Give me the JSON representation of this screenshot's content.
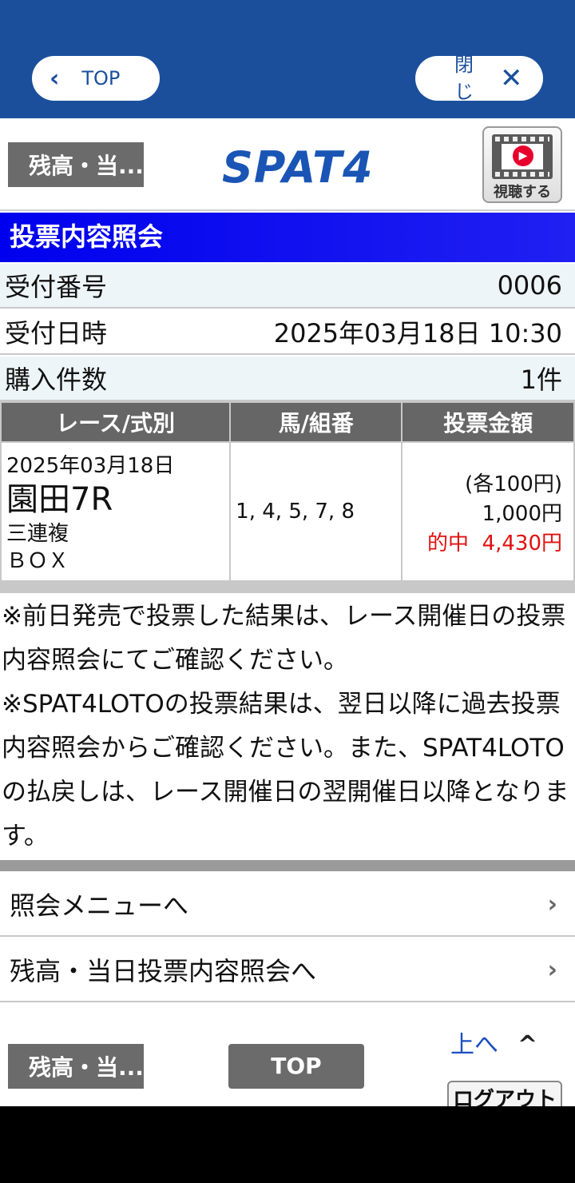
{
  "topbar": {
    "top_label": "TOP",
    "close_label": "閉じる"
  },
  "header": {
    "back_label": "残高・当...",
    "logo": "SPAT4",
    "watch_label": "視聴する"
  },
  "section": {
    "title": "投票内容照会"
  },
  "info": {
    "receipt_label": "受付番号",
    "receipt_value": "0006",
    "datetime_label": "受付日時",
    "datetime_value": "2025年03月18日 10:30",
    "count_label": "購入件数",
    "count_value": "1件"
  },
  "table": {
    "headers": [
      "レース/式別",
      "馬/組番",
      "投票金額"
    ],
    "row": {
      "date": "2025年03月18日",
      "venue": "園田7R",
      "bet_type": "三連複",
      "method": "ＢＯＸ",
      "numbers": "1, 4, 5, 7, 8",
      "unit_amount": "(各100円)",
      "amount": "1,000円",
      "hit_label": "的中",
      "hit_amount": "4,430円"
    }
  },
  "notes": [
    "※前日発売で投票した結果は、レース開催日の投票内容照会にてご確認ください。",
    "※SPAT4LOTOの投票結果は、翌日以降に過去投票内容照会からご確認ください。また、SPAT4LOTOの払戻しは、レース開催日の翌開催日以降となります。"
  ],
  "menu": [
    {
      "label": "照会メニューへ"
    },
    {
      "label": "残高・当日投票内容照会へ"
    }
  ],
  "footer": {
    "back_label": "残高・当...",
    "top_label": "TOP",
    "up_label": "上へ",
    "logout_label": "ログアウト"
  },
  "colors": {
    "topbar": "#1b4f9c",
    "title_bar": "#0000ee",
    "hit": "#e01010",
    "gray_button": "#6b6b6b"
  },
  "icons": {
    "back": "chevron-left-icon",
    "close": "close-icon",
    "menu": "chevron-right-icon",
    "up": "chevron-up-icon",
    "watch": "video-play-icon"
  }
}
